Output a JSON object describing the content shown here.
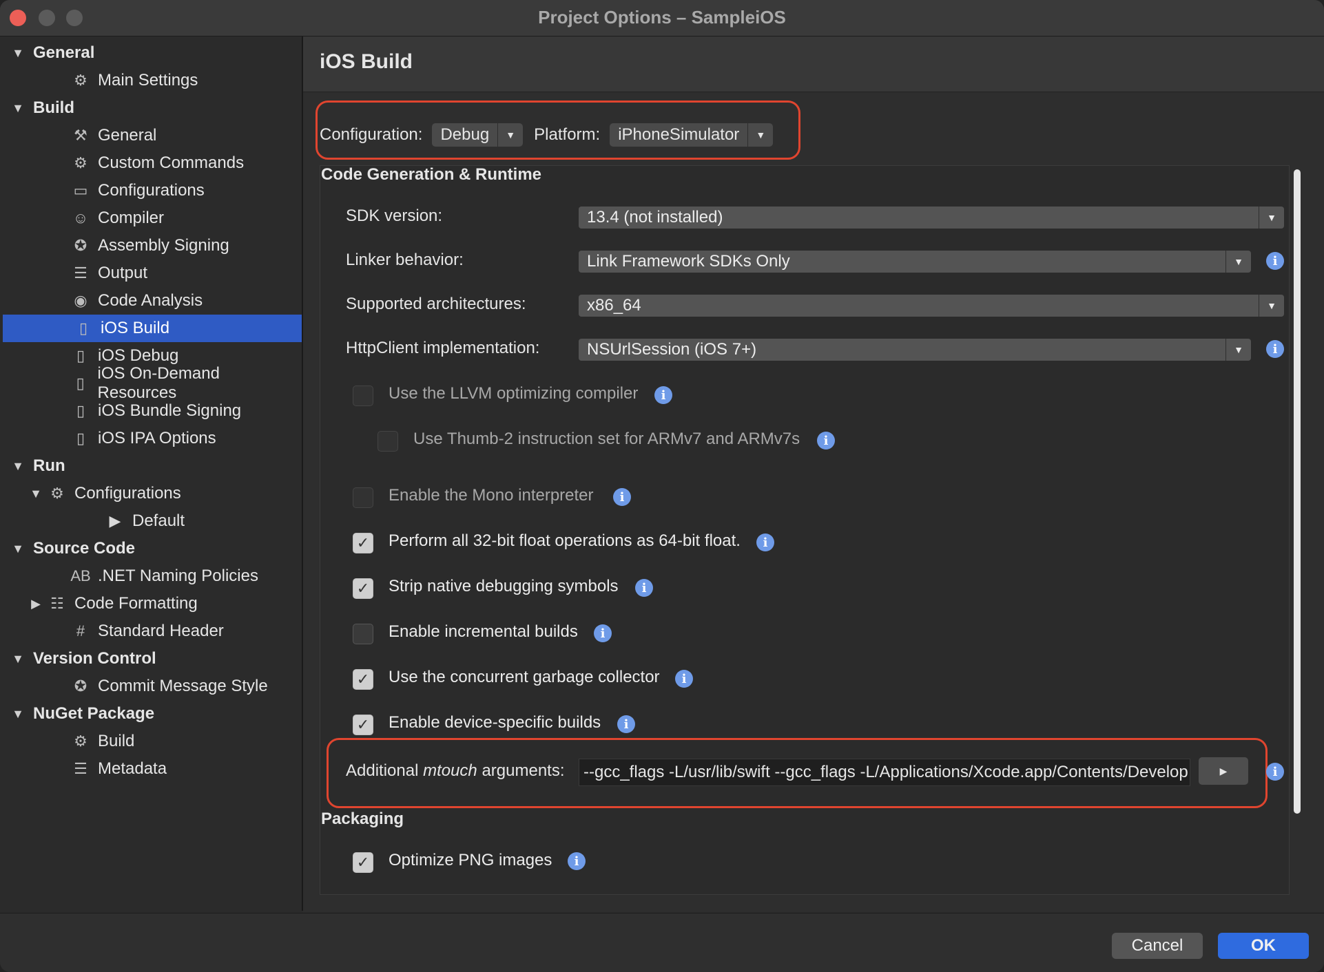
{
  "window": {
    "title": "Project Options – SampleiOS"
  },
  "sidebar": {
    "rows": [
      {
        "label": "General",
        "kind": "section",
        "icon": "triangle-down-icon"
      },
      {
        "label": "Main Settings",
        "kind": "item",
        "icon": "gear-icon"
      },
      {
        "label": "Build",
        "kind": "section",
        "icon": "triangle-down-icon"
      },
      {
        "label": "General",
        "kind": "item",
        "icon": "hammer-icon"
      },
      {
        "label": "Custom Commands",
        "kind": "item",
        "icon": "gear-icon"
      },
      {
        "label": "Configurations",
        "kind": "item",
        "icon": "window-icon"
      },
      {
        "label": "Compiler",
        "kind": "item",
        "icon": "robot-icon"
      },
      {
        "label": "Assembly Signing",
        "kind": "item",
        "icon": "badge-check-icon"
      },
      {
        "label": "Output",
        "kind": "item",
        "icon": "document-lines-icon"
      },
      {
        "label": "Code Analysis",
        "kind": "item",
        "icon": "target-icon"
      },
      {
        "label": "iOS Build",
        "kind": "item",
        "icon": "phone-icon",
        "selected": true
      },
      {
        "label": "iOS Debug",
        "kind": "item",
        "icon": "phone-icon"
      },
      {
        "label": "iOS On-Demand Resources",
        "kind": "item",
        "icon": "phone-icon"
      },
      {
        "label": "iOS Bundle Signing",
        "kind": "item",
        "icon": "phone-icon"
      },
      {
        "label": "iOS IPA Options",
        "kind": "item",
        "icon": "phone-icon"
      },
      {
        "label": "Run",
        "kind": "section",
        "icon": "triangle-down-icon"
      },
      {
        "label": "Configurations",
        "kind": "item-expandable",
        "icon": "gear-icon"
      },
      {
        "label": "Default",
        "kind": "subitem",
        "icon": "play-icon"
      },
      {
        "label": "Source Code",
        "kind": "section",
        "icon": "triangle-down-icon"
      },
      {
        "label": ".NET Naming Policies",
        "kind": "item",
        "icon": "ab-icon"
      },
      {
        "label": "Code Formatting",
        "kind": "item-collapsed",
        "icon": "format-icon"
      },
      {
        "label": "Standard Header",
        "kind": "item",
        "icon": "hash-icon"
      },
      {
        "label": "Version Control",
        "kind": "section",
        "icon": "triangle-down-icon"
      },
      {
        "label": "Commit Message Style",
        "kind": "item",
        "icon": "badge-check-icon"
      },
      {
        "label": "NuGet Package",
        "kind": "section",
        "icon": "triangle-down-icon"
      },
      {
        "label": "Build",
        "kind": "item",
        "icon": "gear-icon"
      },
      {
        "label": "Metadata",
        "kind": "item",
        "icon": "document-lines-icon"
      }
    ]
  },
  "main": {
    "header": "iOS Build",
    "configuration_label": "Configuration:",
    "configuration_value": "Debug",
    "platform_label": "Platform:",
    "platform_value": "iPhoneSimulator",
    "section1": "Code Generation & Runtime",
    "sdk_label": "SDK version:",
    "sdk_value": "13.4 (not installed)",
    "linker_label": "Linker behavior:",
    "linker_value": "Link Framework SDKs Only",
    "arch_label": "Supported architectures:",
    "arch_value": "x86_64",
    "http_label": "HttpClient implementation:",
    "http_value": "NSUrlSession (iOS 7+)",
    "checkboxes": [
      {
        "label": "Use the LLVM optimizing compiler",
        "checked": false,
        "enabled": false
      },
      {
        "label": "Use Thumb-2 instruction set for ARMv7 and ARMv7s",
        "checked": false,
        "enabled": false
      },
      {
        "label": "Enable the Mono interpreter",
        "checked": false,
        "enabled": false
      },
      {
        "label": "Perform all 32-bit float operations as 64-bit float.",
        "checked": true,
        "enabled": true
      },
      {
        "label": "Strip native debugging symbols",
        "checked": true,
        "enabled": true
      },
      {
        "label": "Enable incremental builds",
        "checked": false,
        "enabled": true
      },
      {
        "label": "Use the concurrent garbage collector",
        "checked": true,
        "enabled": true
      },
      {
        "label": "Enable device-specific builds",
        "checked": true,
        "enabled": true
      }
    ],
    "mtouch_label_pre": "Additional ",
    "mtouch_label_em": "mtouch",
    "mtouch_label_post": " arguments:",
    "mtouch_value": "--gcc_flags -L/usr/lib/swift --gcc_flags -L/Applications/Xcode.app/Contents/Develop",
    "section2": "Packaging",
    "png_label": "Optimize PNG images",
    "png_checked": true
  },
  "footer": {
    "cancel": "Cancel",
    "ok": "OK"
  },
  "colors": {
    "accent": "#2f6bdf",
    "selection": "#2f5bc4",
    "highlight": "#e0452f",
    "info": "#6f9be8"
  }
}
